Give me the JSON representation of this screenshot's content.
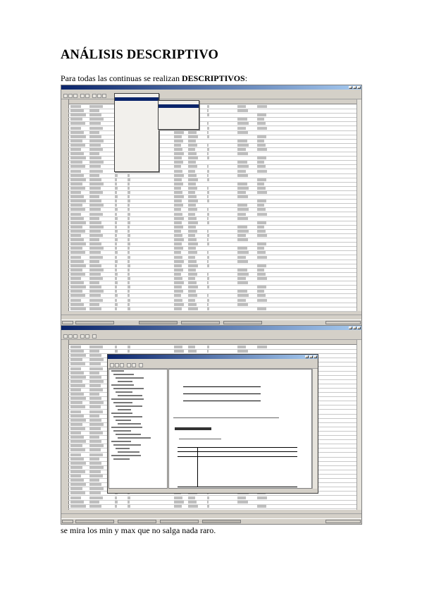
{
  "heading": "ANÁLISIS DESCRIPTIVO",
  "intro": {
    "prefix": "Para todas las continuas se realizan ",
    "bold": "DESCRIPTIVOS",
    "suffix": ":"
  },
  "outro": "se mira los min y max que no salga nada raro."
}
